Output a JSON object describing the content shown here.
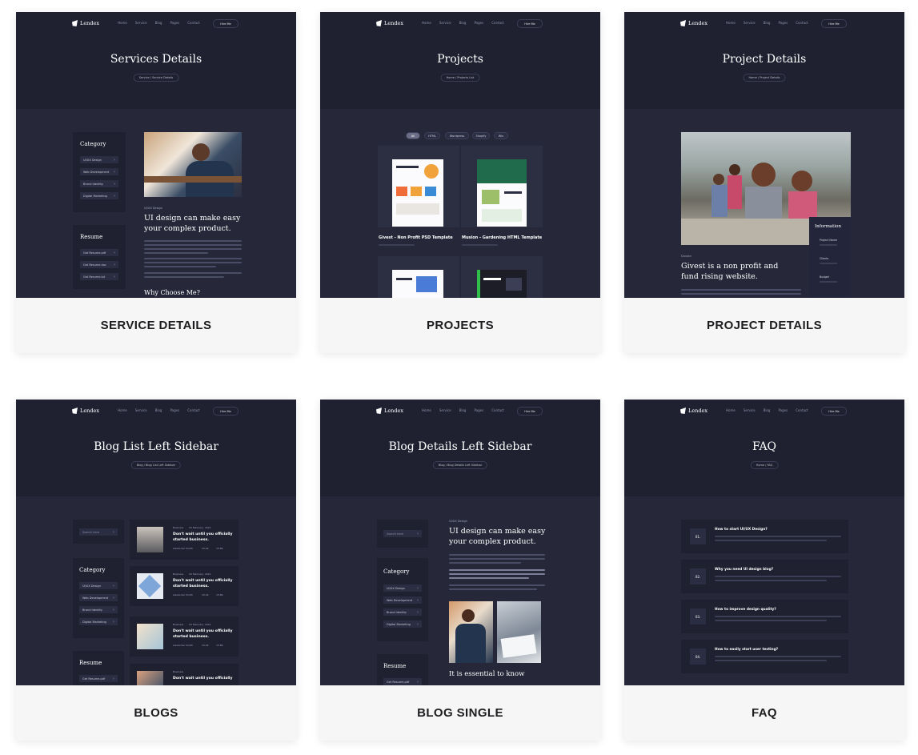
{
  "common": {
    "brand": "Lendex",
    "menu": [
      "Home",
      "Service",
      "Blog",
      "Pages",
      "Contact"
    ],
    "hire_label": "Hire Me",
    "colors": {
      "page_bg": "#ffffff",
      "card_bg": "#f6f6f7",
      "preview_bg": "#262839",
      "hero_bg": "#1f2131"
    }
  },
  "cards": {
    "service_details": {
      "label": "SERVICE DETAILS",
      "hero_title": "Services Details",
      "breadcrumb": "Service / Service Details",
      "category_title": "Category",
      "categories": [
        "UI/UX Design",
        "Web Development",
        "Brand Identity",
        "Digital Marketing"
      ],
      "resume_title": "Resume",
      "resume_items": [
        "Get Resume.pdf",
        "Get Resume.doc",
        "Get Resume.txt"
      ],
      "meta": "UI/UX Design",
      "post_title_1": "UI design can make easy",
      "post_title_2": "your complex product.",
      "why_heading": "Why Choose Me?"
    },
    "projects": {
      "label": "PROJECTS",
      "hero_title": "Projects",
      "breadcrumb": "Home / Projects List",
      "filters": [
        "All",
        "HTML",
        "Wordpress",
        "Shopify",
        "Wix"
      ],
      "project_1": "Givest - Non Profit PSD Template",
      "project_2": "Musion - Gardening HTML Template"
    },
    "project_details": {
      "label": "PROJECT DETAILS",
      "hero_title": "Project Details",
      "breadcrumb": "Home / Project Details",
      "info_title": "Information",
      "info_items": [
        "Project Name",
        "Clients",
        "Budget"
      ],
      "meta": "Donate",
      "post_title_1": "Givest is a non profit and",
      "post_title_2": "fund rising website."
    },
    "blogs": {
      "label": "BLOGS",
      "hero_title": "Blog List Left Sidebar",
      "breadcrumb": "Blog / Blog List Left Sidebar",
      "search_placeholder": "Search here",
      "category_title": "Category",
      "categories": [
        "UI/UX Design",
        "Web Development",
        "Brand Identity",
        "Digital Marketing"
      ],
      "resume_title": "Resume",
      "resume_item": "Get Resume.pdf",
      "post_tag": "Business",
      "post_date": "24 February, 2021",
      "post_title_1": "Don't wait until you officially",
      "post_title_2": "started business.",
      "post_author": "Alexander Smith",
      "post_likes": "10.2K",
      "post_comments": "15.8K"
    },
    "blog_single": {
      "label": "BLOG SINGLE",
      "hero_title": "Blog Details Left Sidebar",
      "breadcrumb": "Blog / Blog Details Left Sidebar",
      "search_placeholder": "Search here",
      "category_title": "Category",
      "categories": [
        "UI/UX Design",
        "Web Development",
        "Brand Identity",
        "Digital Marketing"
      ],
      "resume_title": "Resume",
      "resume_item": "Get Resume.pdf",
      "meta": "UI/UX Design",
      "post_title_1": "UI design can make easy",
      "post_title_2": "your complex product.",
      "second_heading": "It is essential to know"
    },
    "faq": {
      "label": "FAQ",
      "hero_title": "FAQ",
      "breadcrumb": "Home / FAQ",
      "questions": [
        {
          "num": "01.",
          "q": "How to start UI/UX Design?"
        },
        {
          "num": "02.",
          "q": "Why you need UI design blog?"
        },
        {
          "num": "03.",
          "q": "How to improve design quality?"
        },
        {
          "num": "04.",
          "q": "How to easily start user testing?"
        }
      ]
    }
  }
}
